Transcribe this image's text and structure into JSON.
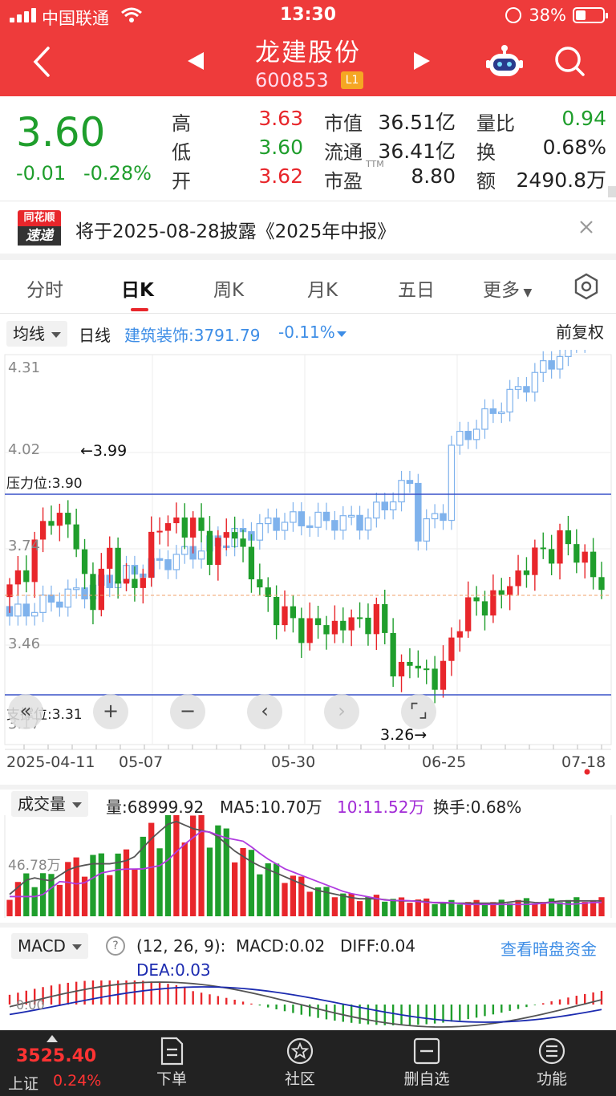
{
  "status": {
    "carrier": "中国联通",
    "time": "13:30",
    "battery": "38%"
  },
  "nav": {
    "stock_name": "龙建股份",
    "stock_code": "600853",
    "level": "L1"
  },
  "quote": {
    "price": "3.60",
    "change": "-0.01",
    "change_pct": "-0.28%",
    "high_label": "高",
    "high": "3.63",
    "low_label": "低",
    "low": "3.60",
    "open_label": "开",
    "open": "3.62",
    "mcap_label": "市值",
    "mcap": "36.51亿",
    "float_label": "流通",
    "float": "36.41亿",
    "pe_label": "市盈",
    "pe_tag": "TTM",
    "pe": "8.80",
    "vr_label": "量比",
    "vr": "0.94",
    "turn_label": "换",
    "turn": "0.68%",
    "amt_label": "额",
    "amt": "2490.8万"
  },
  "notice": {
    "logo_top": "同花顺",
    "logo_bottom": "速递",
    "text": "将于2025-08-28披露《2025年中报》"
  },
  "tabs": [
    "分时",
    "日K",
    "周K",
    "月K",
    "五日",
    "更多"
  ],
  "active_tab": "日K",
  "ma_row": {
    "dropdown": "均线",
    "line_type": "日线",
    "sector": "建筑装饰:3791.79",
    "sector_change": "-0.11%",
    "adjust": "前复权"
  },
  "kline": {
    "y_labels": [
      "4.31",
      "4.02",
      "3.74",
      "3.46",
      "3.17"
    ],
    "resistance_label": "压力位:3.90",
    "support_label": "支撑位:3.31",
    "max_label": "←3.99",
    "min_label": "3.26→",
    "dates": [
      "2025-04-11",
      "05-07",
      "05-30",
      "06-25",
      "07-18"
    ]
  },
  "volume": {
    "dropdown": "成交量",
    "vol": "量:68999.92",
    "ma5": "MA5:10.70万",
    "ma10": "10:11.52万",
    "turnover": "换手:0.68%",
    "y_label": "46.78万"
  },
  "macd": {
    "dropdown": "MACD",
    "help": "?",
    "params": "(12, 26, 9):",
    "macd": "MACD:0.02",
    "diff": "DIFF:0.04",
    "dea": "DEA:0.03",
    "link": "查看暗盘资金",
    "zero_label": "0.00"
  },
  "bottom": {
    "index_value": "3525.40",
    "index_name": "上证",
    "index_pct": "0.24%",
    "items": [
      "下单",
      "社区",
      "删自选",
      "功能"
    ]
  },
  "colors": {
    "header": "#ee3b3b",
    "up": "#e8262b",
    "down": "#1f9e2c",
    "sector_line": "#7fb2ec",
    "level_line": "#3a52c8"
  },
  "chart_data": [
    {
      "type": "candlestick",
      "title": "",
      "series": [
        {
          "name": "",
          "x": [
            "2025-04-11",
            "05-07",
            "05-30",
            "06-25",
            "07-18"
          ],
          "close": [
            3.6,
            3.7,
            3.85,
            3.8,
            3.56,
            3.73,
            3.56,
            3.78,
            3.82,
            3.8,
            3.72,
            3.8,
            3.62,
            3.54,
            3.49,
            3.48,
            3.49,
            3.5,
            3.52,
            3.34,
            3.37,
            3.3,
            3.52,
            3.56,
            3.58,
            3.66,
            3.72,
            3.75,
            3.72,
            3.6
          ]
        }
      ],
      "ylim": [
        3.17,
        4.31
      ],
      "resistance": 3.9,
      "support": 3.31,
      "high": 3.99,
      "low": 3.26
    },
    {
      "type": "bar",
      "title": "",
      "ylabel": "",
      "series": [
        {
          "name": "",
          "values": [
            10,
            18,
            16,
            22,
            24,
            24,
            26,
            36,
            44,
            40,
            38,
            30,
            24,
            20,
            16,
            12,
            10,
            8,
            8,
            7,
            7,
            6,
            6,
            6,
            6,
            7,
            6,
            7,
            7,
            7
          ]
        }
      ]
    }
  ]
}
